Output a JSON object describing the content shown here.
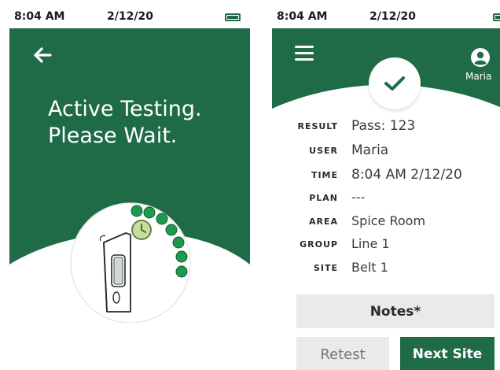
{
  "colors": {
    "brand_green": "#1f6b48",
    "button_gray": "#eaeaea",
    "text_dark": "#2a2a2a"
  },
  "screen1": {
    "status": {
      "time": "8:04 AM",
      "date": "2/12/20"
    },
    "back_icon": "arrow-left-icon",
    "title_line1": "Active Testing.",
    "title_line2": "Please Wait."
  },
  "screen2": {
    "status": {
      "time": "8:04 AM",
      "date": "2/12/20"
    },
    "menu_icon": "hamburger-icon",
    "user_icon": "user-icon",
    "user_name": "Maria",
    "rows": [
      {
        "label": "RESULT",
        "value": "Pass: 123"
      },
      {
        "label": "USER",
        "value": "Maria"
      },
      {
        "label": "TIME",
        "value": "8:04 AM 2/12/20"
      },
      {
        "label": "PLAN",
        "value": "---"
      },
      {
        "label": "AREA",
        "value": "Spice Room"
      },
      {
        "label": "GROUP",
        "value": "Line 1"
      },
      {
        "label": "SITE",
        "value": "Belt 1"
      }
    ],
    "notes_label": "Notes*",
    "retest_label": "Retest",
    "next_label": "Next Site"
  }
}
